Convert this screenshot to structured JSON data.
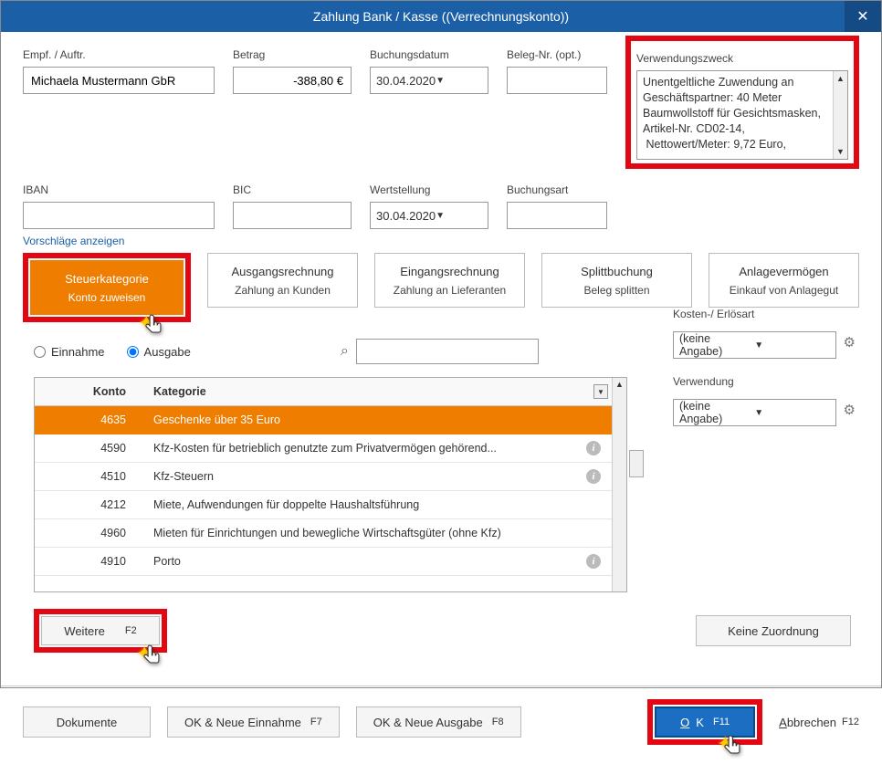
{
  "title": "Zahlung Bank / Kasse ((Verrechnungskonto))",
  "fields": {
    "recipient_label": "Empf. / Auftr.",
    "recipient_value": "Michaela Mustermann GbR",
    "amount_label": "Betrag",
    "amount_value": "-388,80 €",
    "booking_date_label": "Buchungsdatum",
    "booking_date_value": "30.04.2020",
    "receipt_label": "Beleg-Nr. (opt.)",
    "receipt_value": "",
    "purpose_label": "Verwendungszweck",
    "purpose_value": "Unentgeltliche Zuwendung an Geschäftspartner: 40 Meter Baumwollstoff für Gesichtsmasken, Artikel-Nr. CD02-14,\n Nettowert/Meter: 9,72 Euro,",
    "iban_label": "IBAN",
    "iban_value": "",
    "bic_label": "BIC",
    "bic_value": "",
    "value_date_label": "Wertstellung",
    "value_date_value": "30.04.2020",
    "booking_type_label": "Buchungsart",
    "booking_type_value": ""
  },
  "vorschlag_link": "Vorschläge anzeigen",
  "categories": {
    "steuer": {
      "title": "Steuerkategorie",
      "sub": "Konto zuweisen"
    },
    "ausgang": {
      "title": "Ausgangsrechnung",
      "sub": "Zahlung an Kunden"
    },
    "eingang": {
      "title": "Eingangsrechnung",
      "sub": "Zahlung an Lieferanten"
    },
    "split": {
      "title": "Splittbuchung",
      "sub": "Beleg splitten"
    },
    "anlage": {
      "title": "Anlagevermögen",
      "sub": "Einkauf von Anlagegut"
    }
  },
  "radio": {
    "einnahme": "Einnahme",
    "ausgabe": "Ausgabe"
  },
  "side": {
    "kostenart_label": "Kosten-/ Erlösart",
    "kostenart_value": "(keine Angabe)",
    "verwendung_label": "Verwendung",
    "verwendung_value": "(keine Angabe)"
  },
  "table": {
    "head_konto": "Konto",
    "head_kategorie": "Kategorie",
    "rows": [
      {
        "konto": "4635",
        "kat": "Geschenke über 35 Euro",
        "info": false,
        "selected": true
      },
      {
        "konto": "4590",
        "kat": "Kfz-Kosten für betrieblich genutzte zum Privatvermögen gehörend...",
        "info": true,
        "selected": false
      },
      {
        "konto": "4510",
        "kat": "Kfz-Steuern",
        "info": true,
        "selected": false
      },
      {
        "konto": "4212",
        "kat": "Miete, Aufwendungen für doppelte Haushaltsführung",
        "info": false,
        "selected": false
      },
      {
        "konto": "4960",
        "kat": "Mieten für Einrichtungen und bewegliche Wirtschaftsgüter (ohne Kfz)",
        "info": false,
        "selected": false
      },
      {
        "konto": "4910",
        "kat": "Porto",
        "info": true,
        "selected": false
      }
    ]
  },
  "buttons": {
    "weitere": "Weitere",
    "weitere_key": "F2",
    "keine_zuordnung": "Keine Zuordnung",
    "dokumente": "Dokumente",
    "ok_neue_einnahme": "OK & Neue Einnahme",
    "ok_neue_einnahme_key": "F7",
    "ok_neue_ausgabe": "OK & Neue Ausgabe",
    "ok_neue_ausgabe_key": "F8",
    "ok": "OK",
    "ok_key": "F11",
    "abbrechen": "Abbrechen",
    "abbrechen_key": "F12"
  }
}
